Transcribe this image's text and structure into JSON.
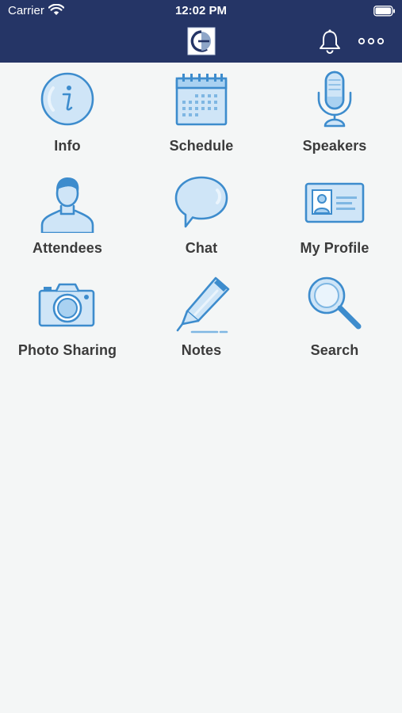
{
  "status_bar": {
    "carrier": "Carrier",
    "time": "12:02 PM"
  },
  "header": {
    "logo_icon": "gd-logo-icon",
    "notification_icon": "bell-icon",
    "more_icon": "more-dots-icon",
    "background_color": "#253566"
  },
  "menu": {
    "items": [
      {
        "label": "Info",
        "icon": "info-icon"
      },
      {
        "label": "Schedule",
        "icon": "calendar-icon"
      },
      {
        "label": "Speakers",
        "icon": "microphone-icon"
      },
      {
        "label": "Attendees",
        "icon": "person-icon"
      },
      {
        "label": "Chat",
        "icon": "chat-bubble-icon"
      },
      {
        "label": "My Profile",
        "icon": "id-card-icon"
      },
      {
        "label": "Photo Sharing",
        "icon": "camera-icon"
      },
      {
        "label": "Notes",
        "icon": "pen-icon"
      },
      {
        "label": "Search",
        "icon": "magnifier-icon"
      }
    ],
    "icon_color": "#3d8ccd",
    "icon_fill": "#cfe5f7"
  }
}
